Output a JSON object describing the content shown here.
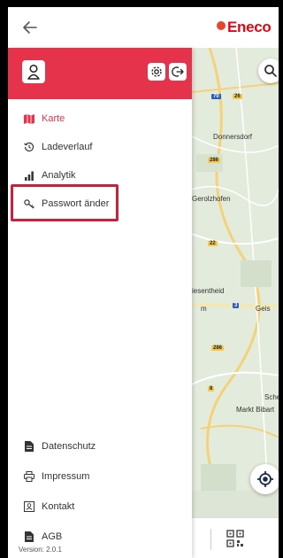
{
  "header": {
    "back_icon": "arrow-left-icon",
    "brand": "Eneco"
  },
  "drawer": {
    "header_color": "#e5334b",
    "active_color": "#e5334b",
    "menu_items": [
      {
        "label": "Karte",
        "icon": "map-icon",
        "active": true
      },
      {
        "label": "Ladeverlauf",
        "icon": "history-icon",
        "active": false
      },
      {
        "label": "Analytik",
        "icon": "bar-chart-icon",
        "active": false
      },
      {
        "label": "Passwort änder",
        "icon": "key-icon",
        "active": false,
        "highlighted": true
      }
    ],
    "footer_items": [
      {
        "label": "Datenschutz",
        "icon": "document-icon"
      },
      {
        "label": "Impressum",
        "icon": "print-icon"
      },
      {
        "label": "Kontakt",
        "icon": "contact-card-icon"
      },
      {
        "label": "AGB",
        "icon": "document-icon"
      }
    ],
    "version": "Version: 2.0.1"
  },
  "map": {
    "labels": [
      {
        "text": "Donnersdorf"
      },
      {
        "text": "Gerolzhofen"
      },
      {
        "text": "iesentheid"
      },
      {
        "text": "m"
      },
      {
        "text": "Geis"
      },
      {
        "text": "Sche"
      },
      {
        "text": "Markt Bibart"
      }
    ],
    "road_badges": [
      "70",
      "26",
      "286",
      "22",
      "3",
      "286",
      "8"
    ]
  }
}
